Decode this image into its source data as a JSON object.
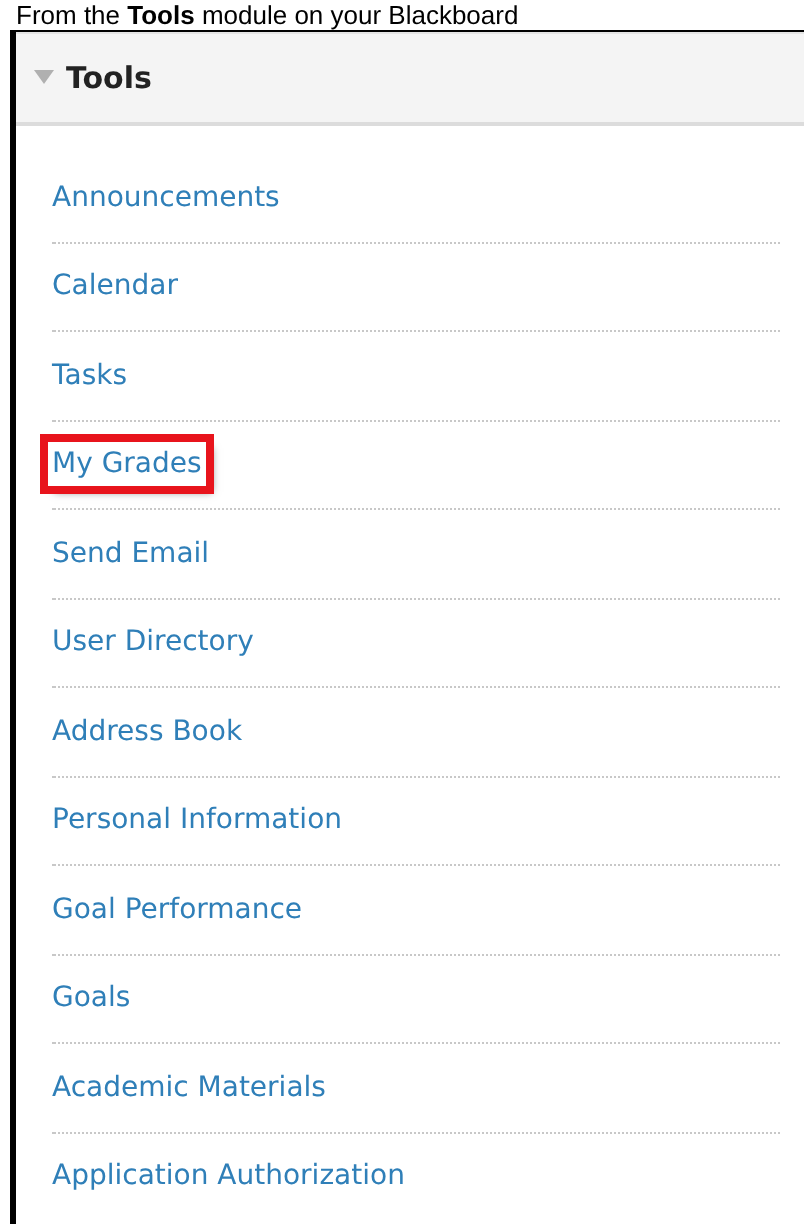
{
  "caption": "From the **Tools** module on your Blackboard",
  "module": {
    "title": "Tools",
    "expanded": true,
    "items": [
      {
        "label": "Announcements",
        "highlighted": false
      },
      {
        "label": "Calendar",
        "highlighted": false
      },
      {
        "label": "Tasks",
        "highlighted": false
      },
      {
        "label": "My Grades",
        "highlighted": true
      },
      {
        "label": "Send Email",
        "highlighted": false
      },
      {
        "label": "User Directory",
        "highlighted": false
      },
      {
        "label": "Address Book",
        "highlighted": false
      },
      {
        "label": "Personal Information",
        "highlighted": false
      },
      {
        "label": "Goal Performance",
        "highlighted": false
      },
      {
        "label": "Goals",
        "highlighted": false
      },
      {
        "label": "Academic Materials",
        "highlighted": false
      },
      {
        "label": "Application Authorization",
        "highlighted": false
      }
    ]
  }
}
